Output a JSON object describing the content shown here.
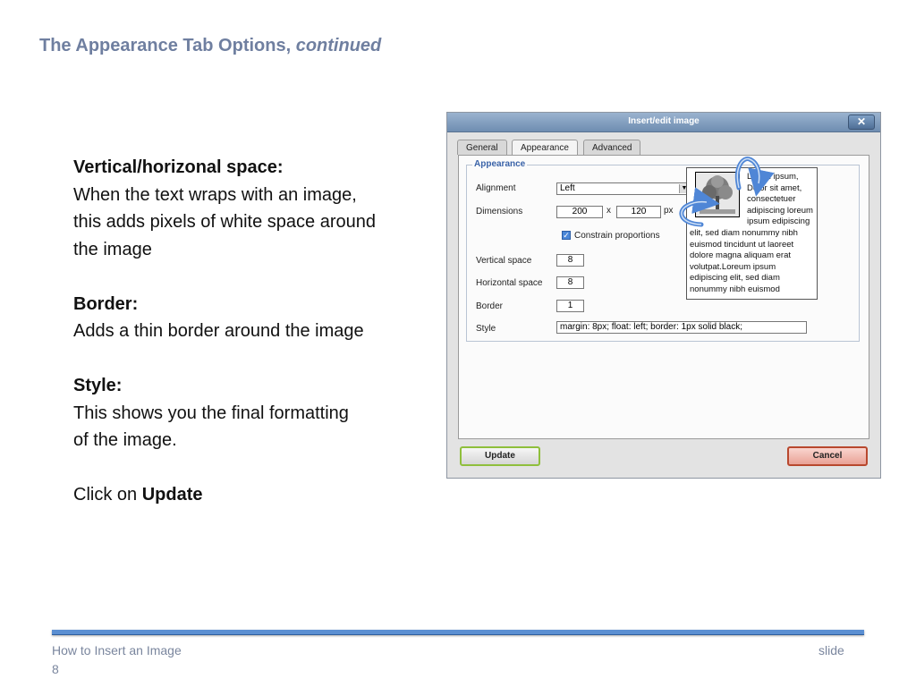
{
  "slide": {
    "title_main": "The Appearance Tab Options, ",
    "title_italic": "continued",
    "sections": [
      {
        "heading": "Vertical/horizonal space:",
        "lines": [
          "When the text wraps with an image,",
          "this adds pixels of white space around",
          "the image"
        ]
      },
      {
        "heading": "Border:",
        "lines": [
          "Adds a thin border around the image"
        ]
      },
      {
        "heading": "Style:",
        "lines": [
          "This shows you the final formatting",
          "of the image."
        ]
      }
    ],
    "click_prefix": "Click on ",
    "click_bold": "Update",
    "footer_left": "How to Insert an Image",
    "footer_right": "slide",
    "footer_number": "8"
  },
  "dialog": {
    "title": "Insert/edit image",
    "close_glyph": "✕",
    "tabs": [
      "General",
      "Appearance",
      "Advanced"
    ],
    "fieldset_legend": "Appearance",
    "labels": {
      "alignment": "Alignment",
      "dimensions": "Dimensions",
      "constrain": "Constrain proportions",
      "vertical_space": "Vertical space",
      "horizontal_space": "Horizontal space",
      "border": "Border",
      "style": "Style"
    },
    "values": {
      "alignment": "Left",
      "width": "200",
      "x_sep": "x",
      "height": "120",
      "unit": "px",
      "vertical_space": "8",
      "horizontal_space": "8",
      "border": "1",
      "style": "margin: 8px; float: left; border: 1px solid black;"
    },
    "preview_text": "Lorem ipsum, Dolor sit amet, consectetuer adipiscing loreum ipsum edipiscing elit, sed diam nonummy nibh euismod tincidunt ut laoreet dolore magna aliquam erat volutpat.Loreum ipsum edipiscing elit, sed diam nonummy nibh euismod",
    "buttons": {
      "update": "Update",
      "cancel": "Cancel"
    }
  },
  "colors": {
    "title": "#6f7fa0",
    "accent_arrow": "#4f86d6",
    "footer_rule": "#5b8fd2"
  },
  "icons": {
    "close": "close-icon",
    "dropdown": "chevron-down-icon",
    "checkbox": "check-icon",
    "preview": "tree-image-icon"
  }
}
